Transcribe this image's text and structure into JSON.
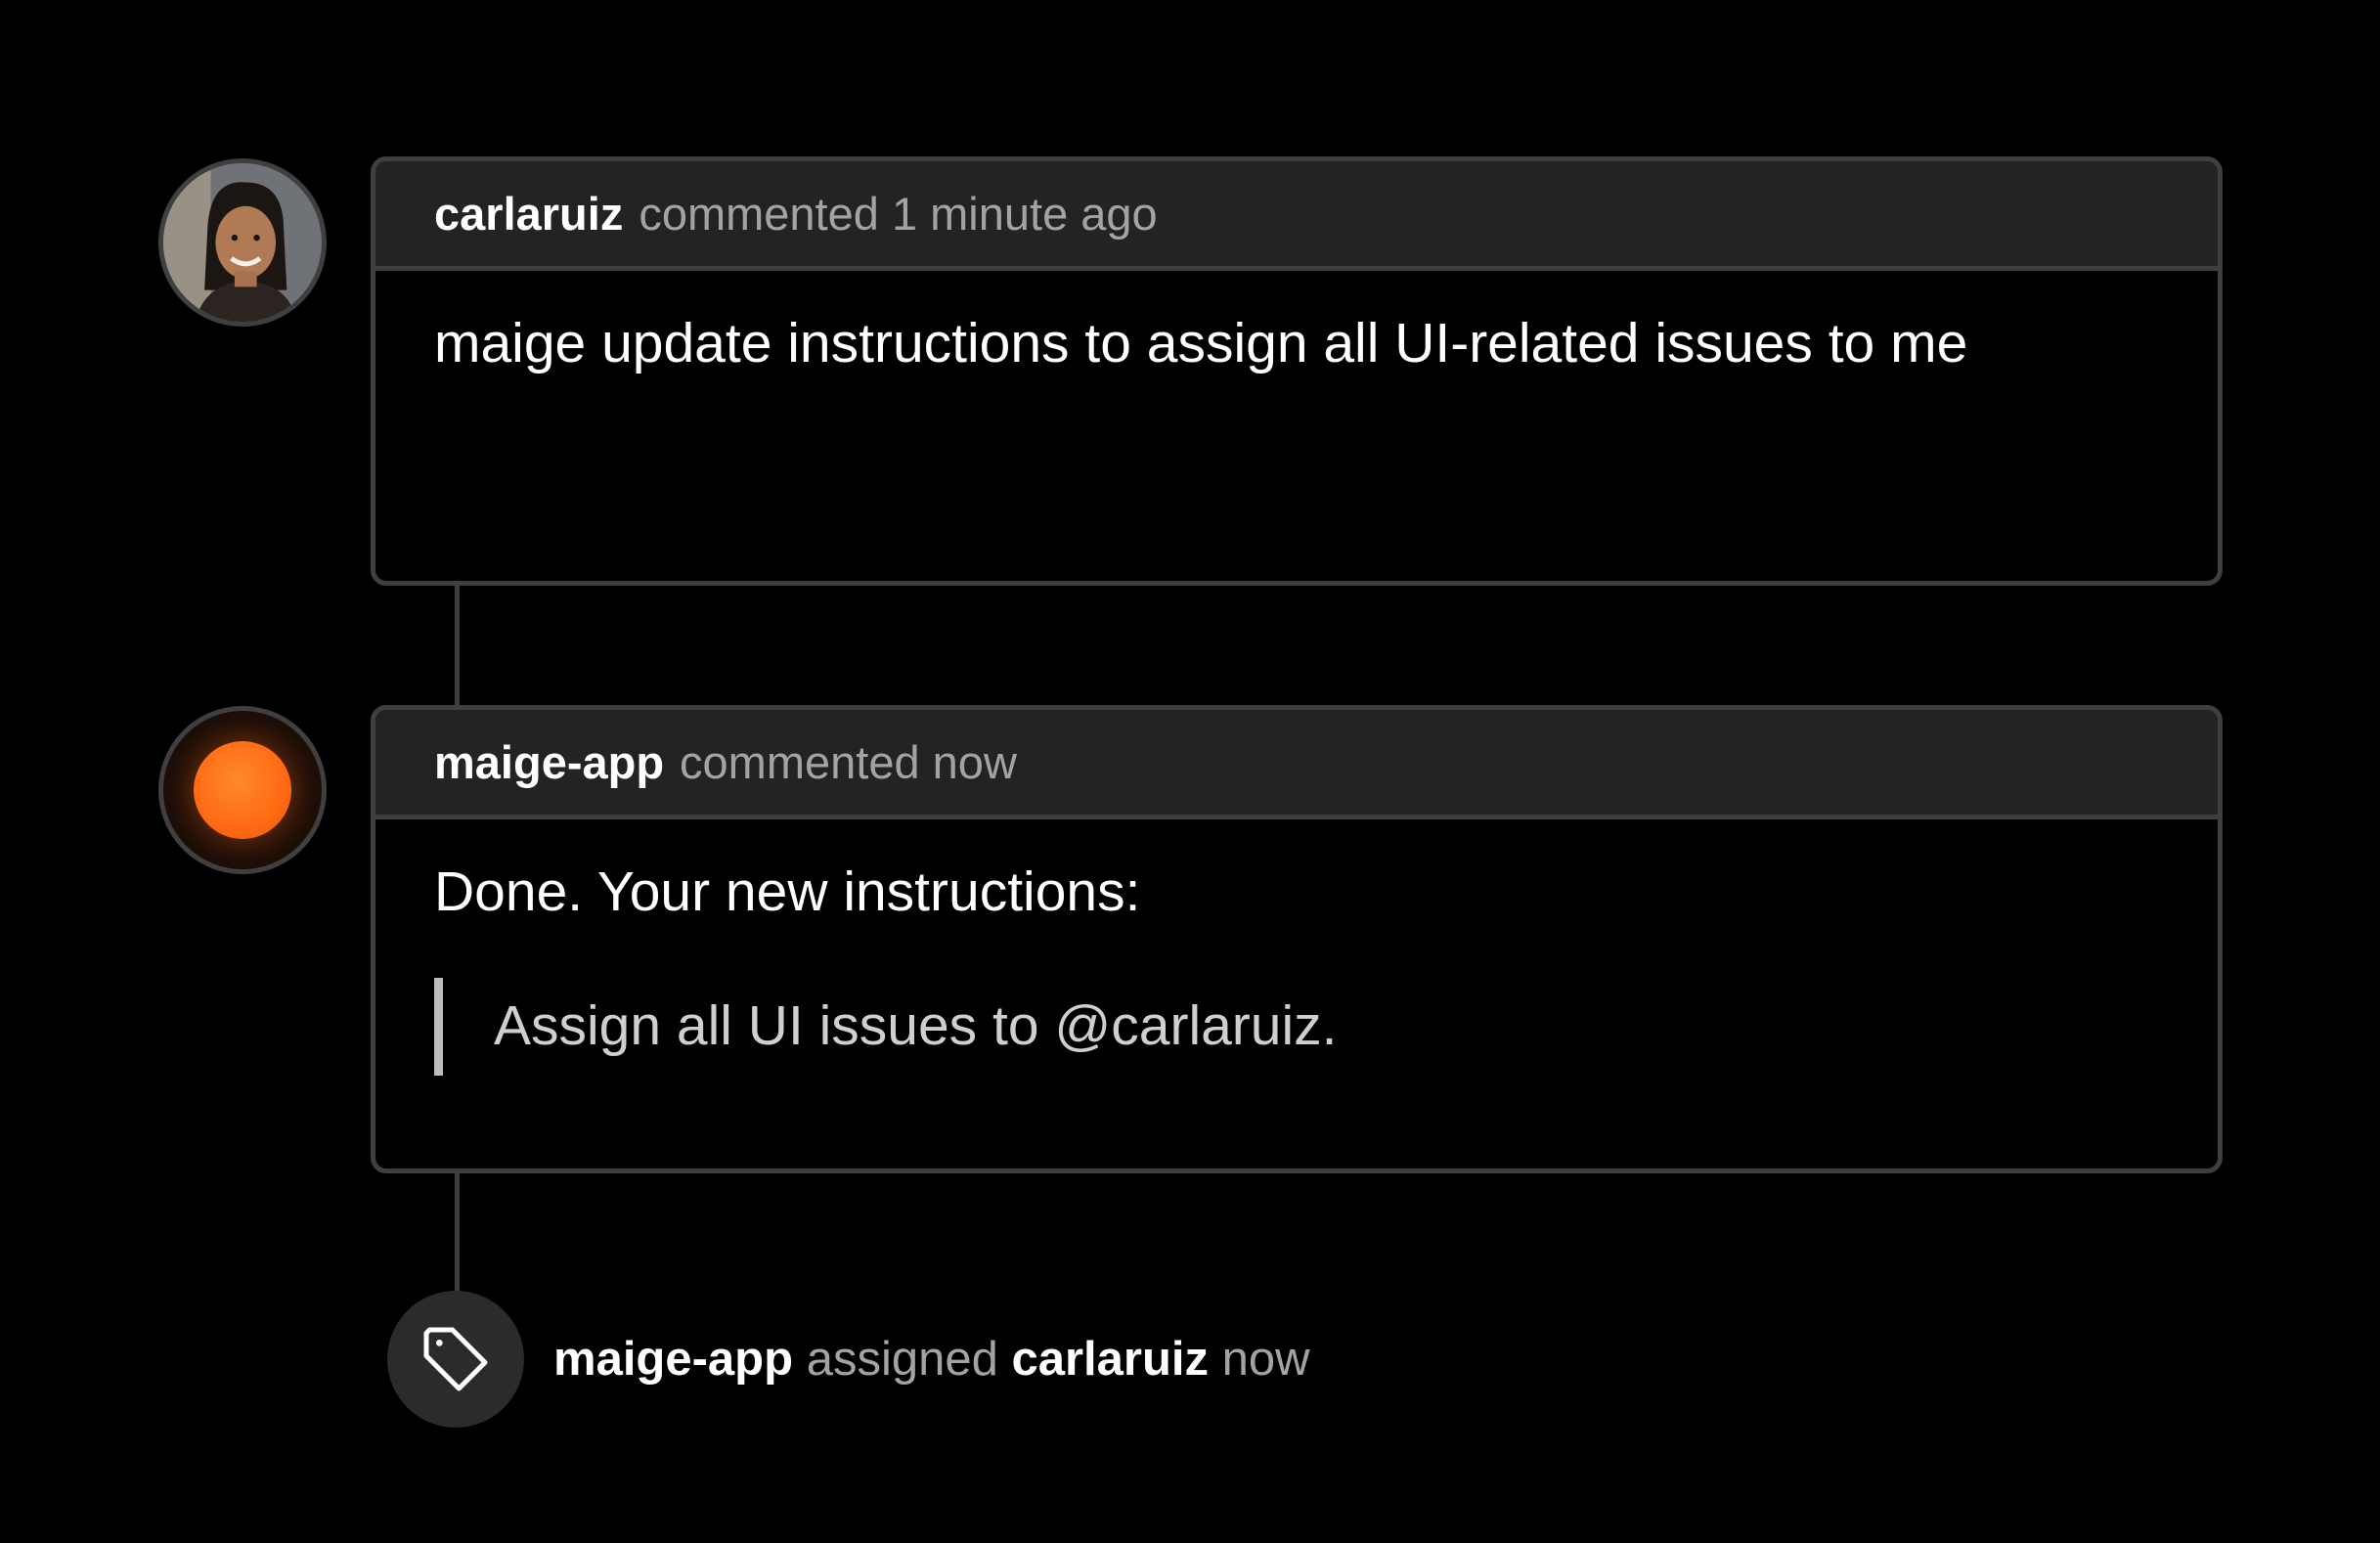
{
  "timeline": {
    "comments": [
      {
        "author": "carlaruiz",
        "meta": "commented 1 minute ago",
        "body": "maige update instructions to assign all UI-related issues to me"
      },
      {
        "author": "maige-app",
        "meta": "commented now",
        "body": "Done. Your new instructions:",
        "quote": "Assign all UI issues to @carlaruiz."
      }
    ],
    "event": {
      "actor": "maige-app",
      "action": "assigned",
      "target": "carlaruiz",
      "time": "now",
      "icon": "tag-icon"
    }
  },
  "colors": {
    "background": "#000000",
    "card_header": "#232323",
    "border": "#3f3f3f",
    "bot_accent": "#ff6a13",
    "muted_text": "#a3a3a3"
  }
}
